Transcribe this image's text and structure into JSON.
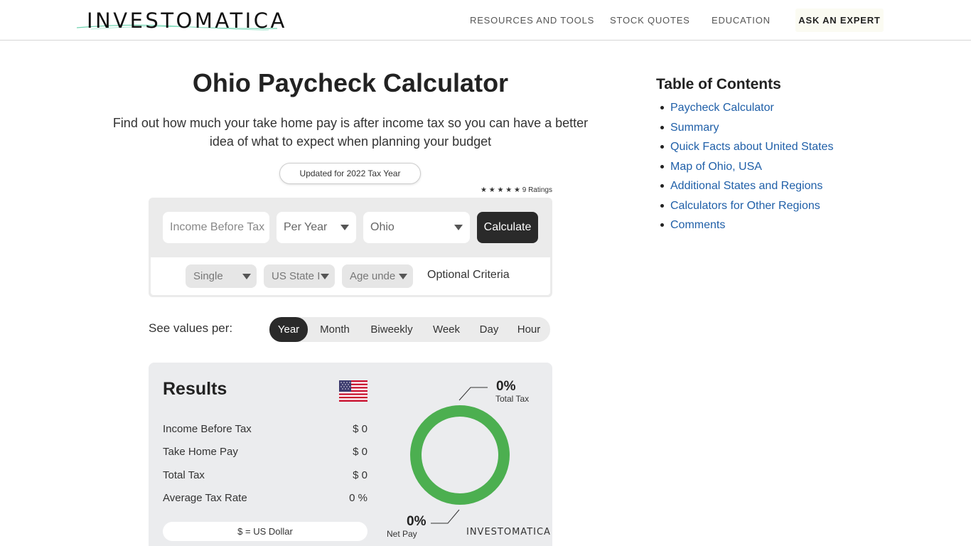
{
  "header": {
    "logo_text": "INVESTOMATICA",
    "nav": [
      "RESOURCES AND TOOLS",
      "STOCK QUOTES",
      "EDUCATION"
    ],
    "ask_expert": "ASK AN EXPERT"
  },
  "main": {
    "title": "Ohio Paycheck Calculator",
    "subtitle": "Find out how much your take home pay is after income tax so you can have a better idea of what to expect when planning your budget",
    "updated": "Updated for 2022 Tax Year",
    "ratings": "★ ★ ★ ★ ★ 9 Ratings"
  },
  "calculator": {
    "income_placeholder": "Income Before Tax",
    "period_select": "Per Year",
    "state_select": "Ohio",
    "calculate_label": "Calculate",
    "status_select": "Single",
    "residency_select": "US State I",
    "age_select": "Age unde",
    "optional_label": "Optional Criteria"
  },
  "values_per": {
    "label": "See values per:",
    "options": [
      "Year",
      "Month",
      "Biweekly",
      "Week",
      "Day",
      "Hour"
    ],
    "active": "Year"
  },
  "results": {
    "title": "Results",
    "rows": [
      {
        "label": "Income Before Tax",
        "value": "$ 0"
      },
      {
        "label": "Take Home Pay",
        "value": "$ 0"
      },
      {
        "label": "Total Tax",
        "value": "$ 0"
      },
      {
        "label": "Average Tax Rate",
        "value": "0 %"
      }
    ],
    "currency": "$ = US Dollar",
    "total_tax_pct": "0%",
    "total_tax_label": "Total Tax",
    "net_pay_pct": "0%",
    "net_pay_label": "Net Pay",
    "watermark": "INVESTOMATICA",
    "donut_color": "#4caf50",
    "net_pay_share": 1.0
  },
  "toc": {
    "title": "Table of Contents",
    "items": [
      "Paycheck Calculator",
      "Summary",
      "Quick Facts about United States",
      "Map of Ohio, USA",
      "Additional States and Regions",
      "Calculators for Other Regions",
      "Comments"
    ]
  }
}
